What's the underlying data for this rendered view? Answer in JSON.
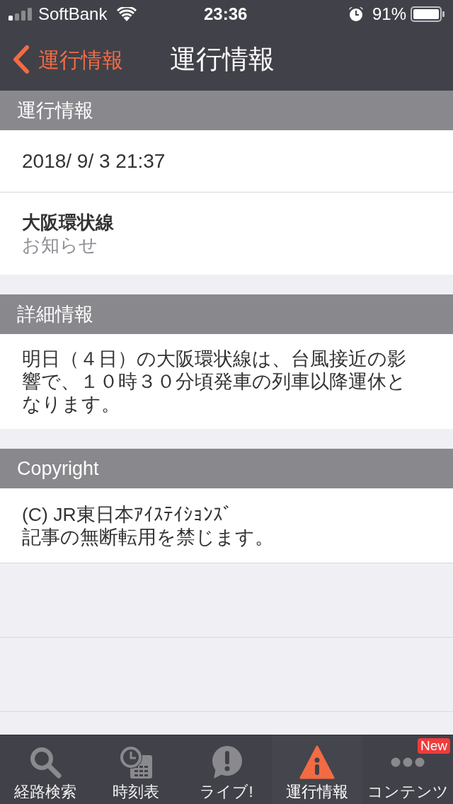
{
  "status_bar": {
    "carrier": "SoftBank",
    "time": "23:36",
    "battery": "91%"
  },
  "nav_bar": {
    "back_label": "運行情報",
    "title": "運行情報"
  },
  "sections": [
    {
      "header": "運行情報",
      "rows": [
        {
          "kind": "text",
          "text": "2018/ 9/ 3 21:37"
        },
        {
          "kind": "titled",
          "title": "大阪環状線",
          "subtitle": "お知らせ"
        }
      ]
    },
    {
      "header": "詳細情報",
      "rows": [
        {
          "kind": "paragraph",
          "text": "明日（４日）の大阪環状線は、台風接近の影響で、１０時３０分頃発車の列車以降運休となります。"
        }
      ]
    },
    {
      "header": "Copyright",
      "rows": [
        {
          "kind": "lines",
          "lines": [
            "(C) JR東日本ｱｲｽﾃｲｼｮﾝｽﾞ",
            "記事の無断転用を禁じます。"
          ]
        }
      ]
    }
  ],
  "tab_bar": [
    {
      "label": "経路検索",
      "selected": false
    },
    {
      "label": "時刻表",
      "selected": false
    },
    {
      "label": "ライブ!",
      "selected": false
    },
    {
      "label": "運行情報",
      "selected": true
    },
    {
      "label": "コンテンツ",
      "selected": false,
      "badge": "New"
    }
  ]
}
